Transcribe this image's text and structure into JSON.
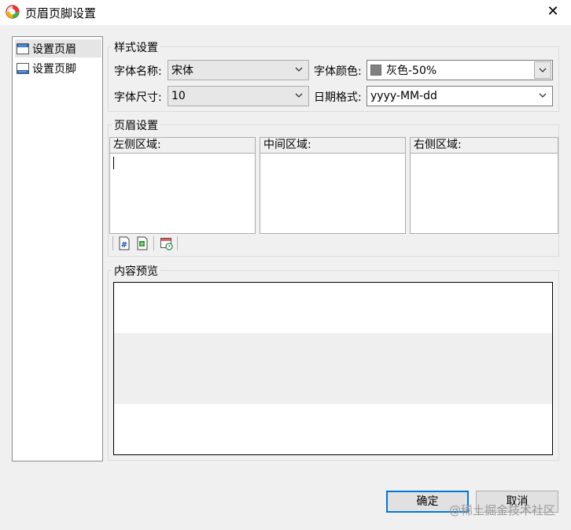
{
  "window": {
    "title": "页眉页脚设置",
    "close_glyph": "✕"
  },
  "nav": {
    "items": [
      {
        "label": "设置页眉",
        "icon": "header-icon",
        "selected": true
      },
      {
        "label": "设置页脚",
        "icon": "footer-icon",
        "selected": false
      }
    ]
  },
  "style_settings": {
    "legend": "样式设置",
    "font_name_label": "字体名称:",
    "font_name_value": "宋体",
    "font_color_label": "字体颜色:",
    "font_color_value": "灰色-50%",
    "font_color_swatch": "#808080",
    "font_size_label": "字体尺寸:",
    "font_size_value": "10",
    "date_format_label": "日期格式:",
    "date_format_value": "yyyy-MM-dd"
  },
  "header_settings": {
    "legend": "页眉设置",
    "regions": [
      {
        "label": "左侧区域:",
        "value": ""
      },
      {
        "label": "中间区域:",
        "value": ""
      },
      {
        "label": "右侧区域:",
        "value": ""
      }
    ],
    "toolbar_icons": [
      "page-number-icon",
      "page-count-icon",
      "date-time-icon"
    ]
  },
  "preview": {
    "legend": "内容预览"
  },
  "buttons": {
    "ok": "确定",
    "cancel": "取消"
  },
  "watermark": "@稀土掘金技术社区",
  "colors": {
    "accent": "#0078d7"
  }
}
